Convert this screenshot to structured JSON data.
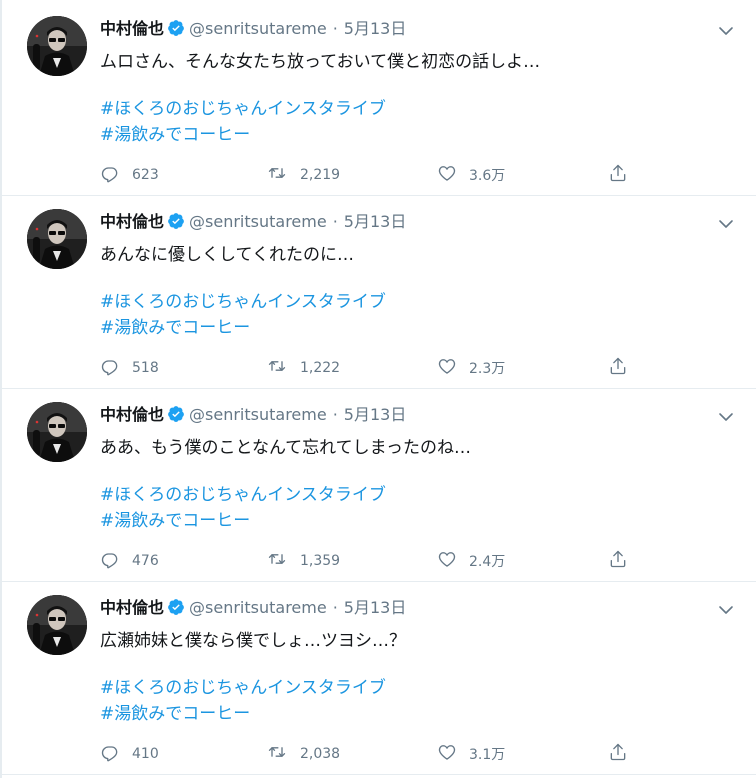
{
  "feed": {
    "colors": {
      "link": "#1b95e0",
      "secondary_text": "#657786",
      "verified_badge": "#1da1f2",
      "divider": "#e6ecf0"
    },
    "tweets": [
      {
        "author": "中村倫也",
        "handle": "@senritsutareme",
        "separator": "·",
        "date": "5月13日",
        "text": "ムロさん、そんな女たち放っておいて僕と初恋の話しよ…",
        "hashtags": [
          "#ほくろのおじちゃんインスタライブ",
          "#湯飲みでコーヒー"
        ],
        "replies": "623",
        "retweets": "2,219",
        "likes": "3.6万"
      },
      {
        "author": "中村倫也",
        "handle": "@senritsutareme",
        "separator": "·",
        "date": "5月13日",
        "text": "あんなに優しくしてくれたのに…",
        "hashtags": [
          "#ほくろのおじちゃんインスタライブ",
          "#湯飲みでコーヒー"
        ],
        "replies": "518",
        "retweets": "1,222",
        "likes": "2.3万"
      },
      {
        "author": "中村倫也",
        "handle": "@senritsutareme",
        "separator": "·",
        "date": "5月13日",
        "text": "ああ、もう僕のことなんて忘れてしまったのね…",
        "hashtags": [
          "#ほくろのおじちゃんインスタライブ",
          "#湯飲みでコーヒー"
        ],
        "replies": "476",
        "retweets": "1,359",
        "likes": "2.4万"
      },
      {
        "author": "中村倫也",
        "handle": "@senritsutareme",
        "separator": "·",
        "date": "5月13日",
        "text": "広瀬姉妹と僕なら僕でしょ…ツヨシ…？",
        "hashtags": [
          "#ほくろのおじちゃんインスタライブ",
          "#湯飲みでコーヒー"
        ],
        "replies": "410",
        "retweets": "2,038",
        "likes": "3.1万"
      }
    ]
  }
}
